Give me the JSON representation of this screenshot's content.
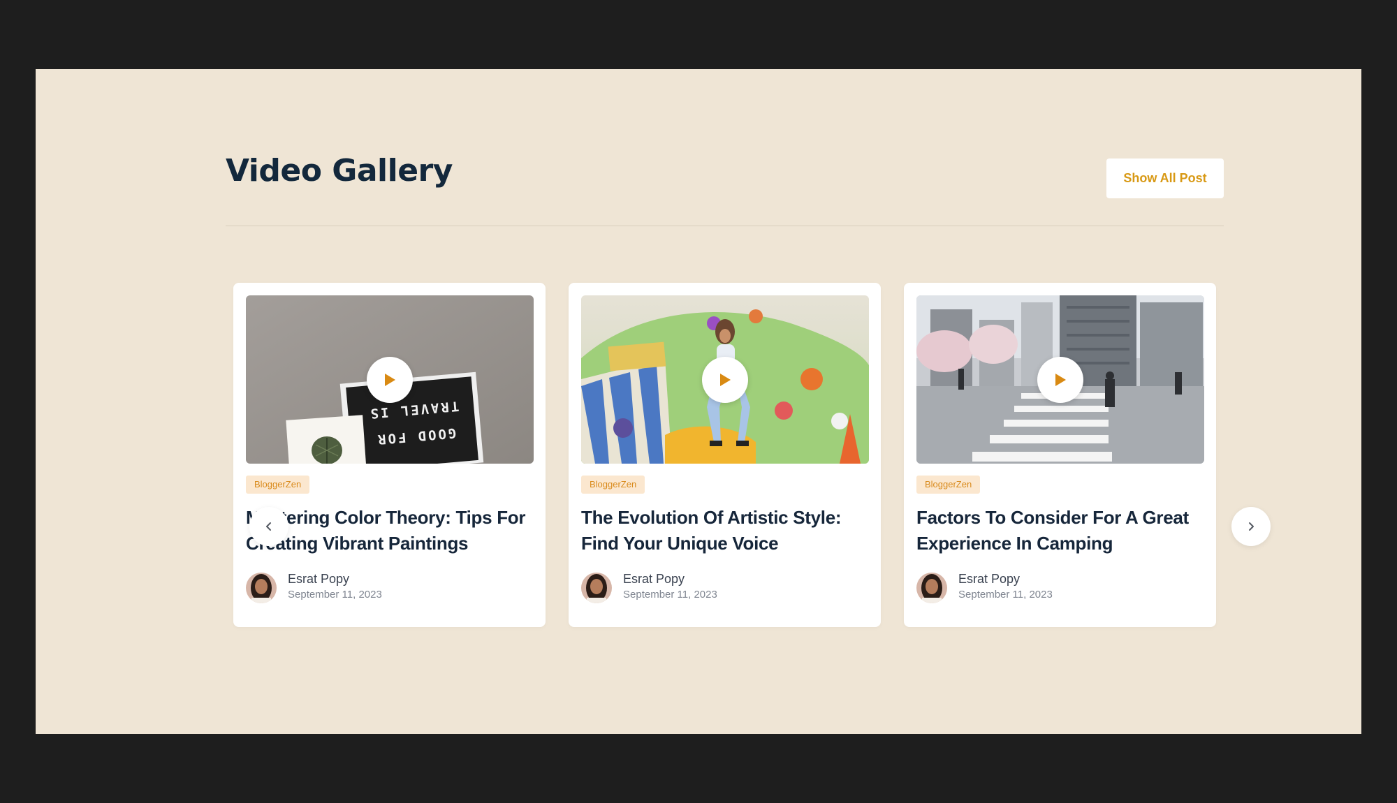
{
  "section": {
    "title": "Video Gallery",
    "show_all_label": "Show All Post"
  },
  "carousel": {
    "prev_icon": "chevron-left-icon",
    "next_icon": "chevron-right-icon"
  },
  "posts": [
    {
      "category": "BloggerZen",
      "title": "Mastering Color Theory: Tips For Creating Vibrant Paintings",
      "author": "Esrat Popy",
      "date": "September 11, 2023",
      "thumbnail_sign_line1": "TRAVEL IS",
      "thumbnail_sign_line2": "GOOD FOR"
    },
    {
      "category": "BloggerZen",
      "title": "The Evolution Of Artistic Style: Find Your Unique Voice",
      "author": "Esrat Popy",
      "date": "September 11, 2023"
    },
    {
      "category": "BloggerZen",
      "title": "Factors To Consider For A Great Experience In Camping",
      "author": "Esrat Popy",
      "date": "September 11, 2023"
    }
  ],
  "colors": {
    "page_background": "#efe5d5",
    "outer_background": "#1e1e1e",
    "accent": "#d89915",
    "badge_background": "#fbe7cf",
    "title_text": "#13283c"
  }
}
